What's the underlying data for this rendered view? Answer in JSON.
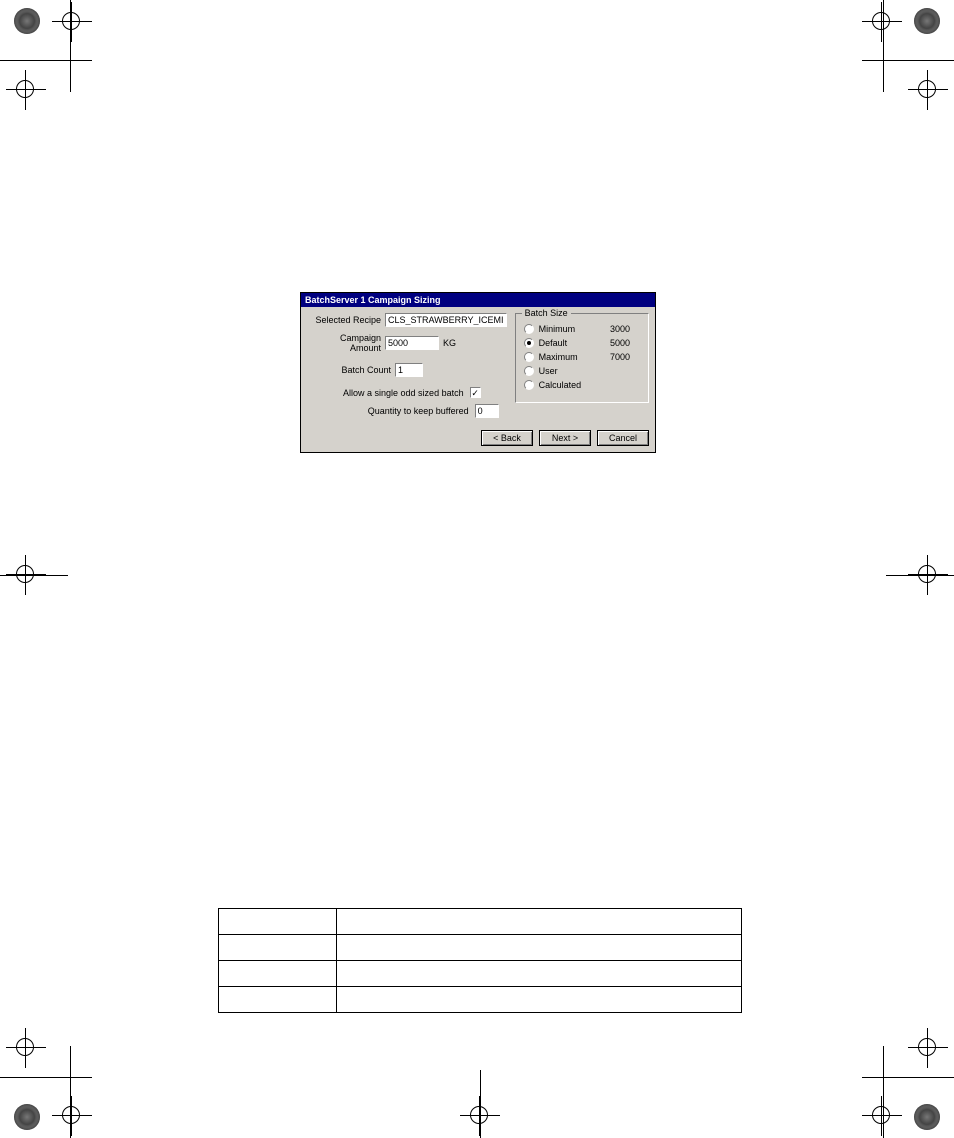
{
  "dialog": {
    "title": "BatchServer 1 Campaign Sizing",
    "selected_recipe_label": "Selected Recipe",
    "selected_recipe_value": "CLS_STRAWBERRY_ICEMILK",
    "campaign_amount_label": "Campaign Amount",
    "campaign_amount_value": "5000",
    "campaign_amount_unit": "KG",
    "batch_count_label": "Batch Count",
    "batch_count_value": "1",
    "allow_odd_label": "Allow a single odd sized batch",
    "allow_odd_checked": true,
    "qty_buffered_label": "Quantity to keep buffered",
    "qty_buffered_value": "0",
    "batch_size_legend": "Batch Size",
    "radios": [
      {
        "label": "Minimum",
        "value": "3000",
        "checked": false
      },
      {
        "label": "Default",
        "value": "5000",
        "checked": true
      },
      {
        "label": "Maximum",
        "value": "7000",
        "checked": false
      },
      {
        "label": "User",
        "value": "",
        "checked": false
      },
      {
        "label": "Calculated",
        "value": "",
        "checked": false
      }
    ],
    "buttons": {
      "back": "< Back",
      "next": "Next >",
      "cancel": "Cancel"
    }
  },
  "table": {
    "rows": [
      [
        "",
        ""
      ],
      [
        "",
        ""
      ],
      [
        "",
        ""
      ],
      [
        "",
        ""
      ]
    ]
  }
}
